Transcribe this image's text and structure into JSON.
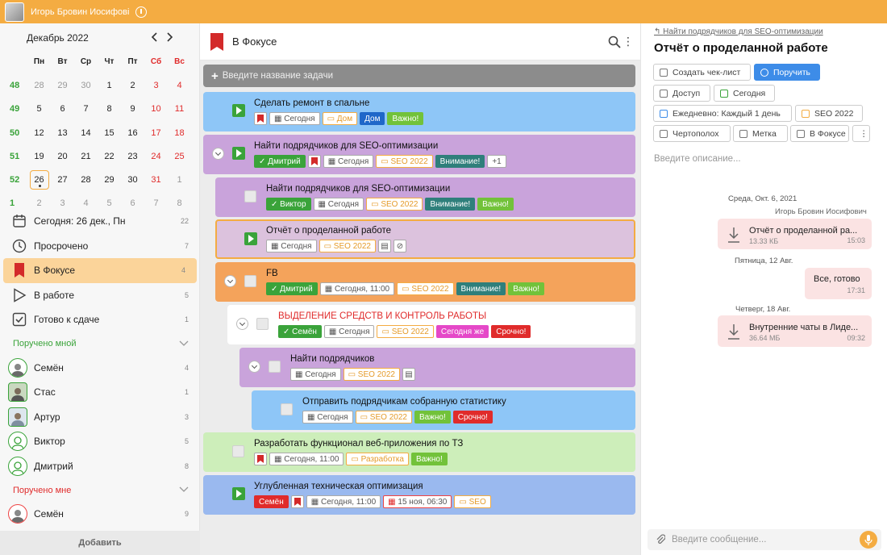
{
  "topbar": {
    "user_name": "Игорь Бровин Иосифовi"
  },
  "calendar": {
    "month": "Декабрь 2022",
    "weekdays": [
      "Пн",
      "Вт",
      "Ср",
      "Чт",
      "Пт",
      "Сб",
      "Вс"
    ],
    "weeks": [
      {
        "num": "48",
        "days": [
          "28",
          "29",
          "30",
          "1",
          "2",
          "3",
          "4"
        ]
      },
      {
        "num": "49",
        "days": [
          "5",
          "6",
          "7",
          "8",
          "9",
          "10",
          "11"
        ]
      },
      {
        "num": "50",
        "days": [
          "12",
          "13",
          "14",
          "15",
          "16",
          "17",
          "18"
        ]
      },
      {
        "num": "51",
        "days": [
          "19",
          "20",
          "21",
          "22",
          "23",
          "24",
          "25"
        ]
      },
      {
        "num": "52",
        "days": [
          "26",
          "27",
          "28",
          "29",
          "30",
          "31",
          "1"
        ]
      },
      {
        "num": "1",
        "days": [
          "2",
          "3",
          "4",
          "5",
          "6",
          "7",
          "8"
        ]
      }
    ]
  },
  "nav": [
    {
      "label": "Сегодня: 26 дек., Пн",
      "count": "22"
    },
    {
      "label": "Просрочено",
      "count": "7"
    },
    {
      "label": "В Фокусе",
      "count": "4"
    },
    {
      "label": "В работе",
      "count": "5"
    },
    {
      "label": "Готово к сдаче",
      "count": "1"
    }
  ],
  "assigned_by_me": {
    "title": "Поручено мной",
    "people": [
      {
        "name": "Семён",
        "count": "4"
      },
      {
        "name": "Стас",
        "count": "1"
      },
      {
        "name": "Артур",
        "count": "3"
      },
      {
        "name": "Виктор",
        "count": "5"
      },
      {
        "name": "Дмитрий",
        "count": "8"
      }
    ]
  },
  "assigned_to_me": {
    "title": "Поручено мне",
    "people": [
      {
        "name": "Семён",
        "count": "9"
      }
    ]
  },
  "add_label": "Добавить",
  "center": {
    "title": "В Фокусе",
    "new_task_placeholder": "Введите название задачи",
    "tasks": [
      {
        "title": "Сделать ремонт в спальне",
        "tags": [
          "Сегодня",
          "Дом",
          "Дом",
          "Важно!"
        ]
      },
      {
        "title": "Найти подрядчиков для SEO-оптимизации",
        "tags": [
          "Дмитрий",
          "Сегодня",
          "SEO 2022",
          "Внимание!",
          "+1"
        ]
      },
      {
        "title": "Найти подрядчиков для SEO-оптимизации",
        "tags": [
          "Виктор",
          "Сегодня",
          "SEO 2022",
          "Внимание!",
          "Важно!"
        ]
      },
      {
        "title": "Отчёт о проделанной работе",
        "tags": [
          "Сегодня",
          "SEO 2022"
        ]
      },
      {
        "title": "FB",
        "tags": [
          "Дмитрий",
          "Сегодня, 11:00",
          "SEO 2022",
          "Внимание!",
          "Важно!"
        ]
      },
      {
        "title": "ВЫДЕЛЕНИЕ СРЕДСТВ И КОНТРОЛЬ РАБОТЫ",
        "tags": [
          "Семён",
          "Сегодня",
          "SEO 2022",
          "Сегодня же",
          "Срочно!"
        ]
      },
      {
        "title": "Найти подрядчиков",
        "tags": [
          "Сегодня",
          "SEO 2022"
        ]
      },
      {
        "title": "Отправить подрядчикам собранную статистику",
        "tags": [
          "Сегодня",
          "SEO 2022",
          "Важно!",
          "Срочно!"
        ]
      },
      {
        "title": "Разработать функционал веб-приложения по ТЗ",
        "tags": [
          "Сегодня, 11:00",
          "Разработка",
          "Важно!"
        ]
      },
      {
        "title": "Углубленная техническая оптимизация",
        "tags": [
          "Семён",
          "Сегодня, 11:00",
          "15 ноя, 06:30",
          "SEO"
        ]
      }
    ]
  },
  "detail": {
    "breadcrumb": "Найти подрядчиков для SEO-оптимизации",
    "title": "Отчёт о проделанной работе",
    "buttons": {
      "checklist": "Создать чек-лист",
      "assign": "Поручить",
      "access": "Доступ",
      "today": "Сегодня",
      "repeat": "Ежедневно: Каждый 1 день",
      "folder": "SEO 2022",
      "person": "Чертополох",
      "label": "Метка",
      "focus": "В Фокусе",
      "more": "⋮"
    },
    "description_placeholder": "Введите описание...",
    "chat": [
      {
        "date": "Среда, Окт. 6, 2021",
        "author": "Игорь Бровин Иосифович",
        "file": "Отчёт о проделанной ра...",
        "size": "13.33 КБ",
        "time": "15:03"
      },
      {
        "date": "Пятница, 12 Авг.",
        "text": "Все, готово",
        "time": "17:31"
      },
      {
        "date": "Четверг, 18 Авг.",
        "file": "Внутренние чаты в Лиде...",
        "size": "36.64 МБ",
        "time": "09:32"
      }
    ],
    "message_placeholder": "Введите сообщение..."
  },
  "colors": {
    "accent": "#f4ac42",
    "green": "#3aa33a",
    "urgent": "#e02b2b",
    "blue": "#3d8ce8"
  }
}
